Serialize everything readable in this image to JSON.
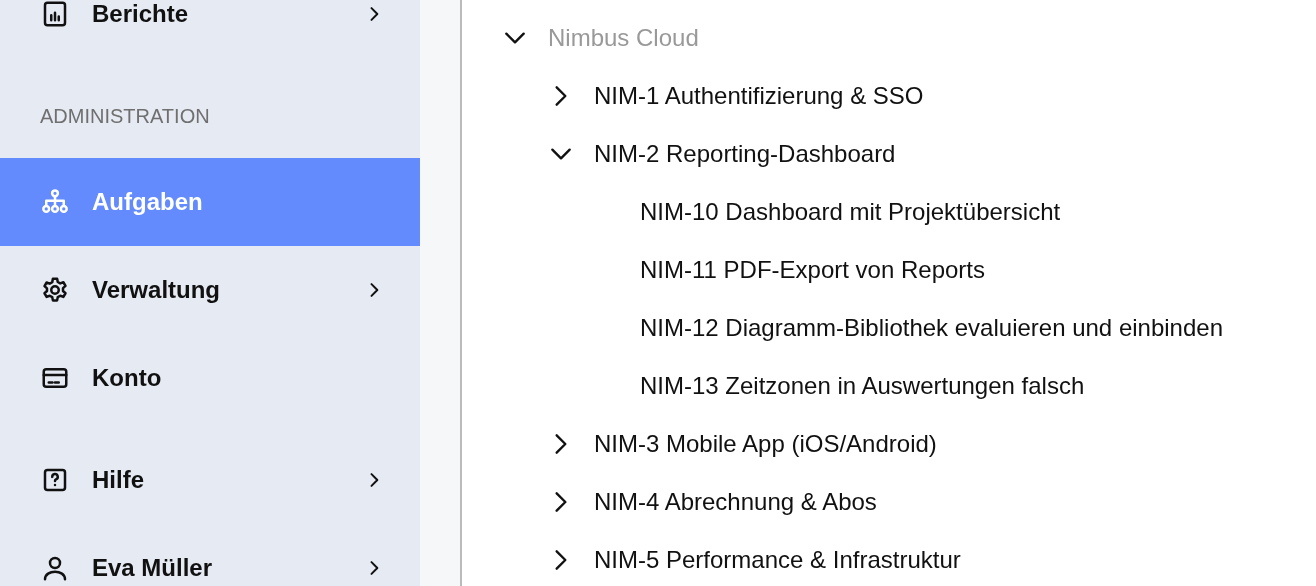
{
  "sidebar": {
    "items": [
      {
        "kind": "link",
        "label": "Berichte",
        "selected": false,
        "has_submenu": true
      },
      {
        "kind": "heading",
        "label": "ADMINISTRATION"
      },
      {
        "kind": "link",
        "label": "Aufgaben",
        "selected": true,
        "has_submenu": false
      },
      {
        "kind": "link",
        "label": "Verwaltung",
        "selected": false,
        "has_submenu": true
      },
      {
        "kind": "link",
        "label": "Konto",
        "selected": false,
        "has_submenu": false
      }
    ],
    "footer_items": [
      {
        "kind": "link",
        "label": "Hilfe",
        "selected": false,
        "has_submenu": true
      },
      {
        "kind": "link",
        "label": "Eva Müller",
        "selected": false,
        "has_submenu": true
      }
    ]
  },
  "tree": {
    "label": "Nimbus Cloud",
    "expanded": true,
    "children": [
      {
        "label": "NIM-1 Authentifizierung & SSO",
        "expanded": false
      },
      {
        "label": "NIM-2 Reporting-Dashboard",
        "expanded": true,
        "children": [
          {
            "label": "NIM-10 Dashboard mit Projektübersicht"
          },
          {
            "label": "NIM-11 PDF-Export von Reports"
          },
          {
            "label": "NIM-12 Diagramm-Bibliothek evaluieren und einbinden"
          },
          {
            "label": "NIM-13 Zeitzonen in Auswertungen falsch"
          }
        ]
      },
      {
        "label": "NIM-3 Mobile App (iOS/Android)",
        "expanded": false
      },
      {
        "label": "NIM-4 Abrechnung & Abos",
        "expanded": false
      },
      {
        "label": "NIM-5 Performance & Infrastruktur",
        "expanded": false
      }
    ]
  }
}
